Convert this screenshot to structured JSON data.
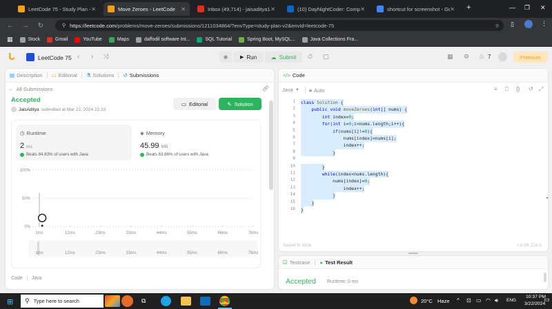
{
  "browser": {
    "tabs": [
      {
        "title": "LeetCode 75 - Study Plan - L",
        "color": "#f0a020",
        "active": false
      },
      {
        "title": "Move Zeroes - LeetCode",
        "color": "#f0a020",
        "active": true
      },
      {
        "title": "Inbox (49,714) - jaisaditya14",
        "color": "#d93025",
        "active": false
      },
      {
        "title": "(10) DayNightCoder: Compl",
        "color": "#0a66c2",
        "active": false
      },
      {
        "title": "shortcut for screenshot - Go",
        "color": "#4285f4",
        "active": false
      }
    ],
    "new_tab": "+",
    "url_host": "https://leetcode.com",
    "url_path": "/problems/move-zeroes/submissions/1211034864/?envType=study-plan-v2&envId=leetcode-75",
    "bookmarks": [
      {
        "label": "Stock",
        "color": "#9aa0a6"
      },
      {
        "label": "Gmail",
        "color": "#d93025"
      },
      {
        "label": "YouTube",
        "color": "#ff0000"
      },
      {
        "label": "Maps",
        "color": "#34a853"
      },
      {
        "label": "daffodil software Int...",
        "color": "#9aa0a6"
      },
      {
        "label": "SQL Tutorial",
        "color": "#04aa6d"
      },
      {
        "label": "Spring Boot, MySQL...",
        "color": "#6db33f"
      },
      {
        "label": "Java Collections Fra...",
        "color": "#9aa0a6"
      }
    ]
  },
  "header": {
    "study_plan": "LeetCode 75",
    "run": "Run",
    "submit": "Submit",
    "streak": "7",
    "premium": "Premium"
  },
  "left_tabs": [
    "Description",
    "Editorial",
    "Solutions",
    "Submissions"
  ],
  "submission": {
    "back": "All Submissions",
    "status": "Accepted",
    "user": "JaisAditya",
    "submitted_at": "submitted at Mar 22, 2024 22:33",
    "editorial_btn": "Editorial",
    "solution_btn": "Solution",
    "runtime": {
      "label": "Runtime",
      "value": "2",
      "unit": "ms",
      "beats_label": "Beats",
      "beats": "84.83%",
      "suffix": "of users with Java"
    },
    "memory": {
      "label": "Memory",
      "value": "45.99",
      "unit": "MB",
      "beats_label": "Beats",
      "beats": "63.86%",
      "suffix": "of users with Java"
    },
    "footer_left": "Code",
    "footer_lang": "Java"
  },
  "chart_data": {
    "type": "bar",
    "title": "",
    "xlabel": "",
    "ylabel": "",
    "categories": [
      "1ms",
      "12ms",
      "23ms",
      "33ms",
      "44ms",
      "55ms",
      "66ms",
      "76ms"
    ],
    "yticks": [
      "100%",
      "50%",
      "0%"
    ],
    "ylim": [
      0,
      100
    ],
    "values": [
      60,
      0.4,
      0.2,
      0.1,
      0.1,
      0.1,
      0.1,
      0.1
    ],
    "marker": {
      "x": "2ms",
      "y": 15
    },
    "overview_categories": [
      "1ms",
      "12ms",
      "23ms",
      "33ms",
      "44ms",
      "55ms",
      "66ms",
      "76ms"
    ]
  },
  "code_panel": {
    "title": "Code",
    "language": "Java",
    "mode": "Auto",
    "saved": "Saved to local",
    "cursor": "Ln 16, Col 2",
    "lines": [
      "class Solution {",
      "    public void moveZeroes(int[] nums) {",
      "        int index=0;",
      "        for(int i=0;i<nums.length;i++){",
      "            if(nums[i]!=0){",
      "                nums[index]=nums[i];",
      "                index++;",
      "            }",
      "",
      "        }",
      "        while(index<nums.length){",
      "            nums[index]=0;",
      "                index++;",
      "            }",
      "    }",
      "}"
    ]
  },
  "result_panel": {
    "testcase_tab": "Testcase",
    "result_tab": "Test Result",
    "status": "Accepted",
    "runtime": "Runtime: 0 ms"
  },
  "taskbar": {
    "search_placeholder": "Type here to search",
    "weather": "20°C",
    "weather_desc": "Haze",
    "lang": "ENG",
    "time": "10:37 PM",
    "date": "3/22/2024"
  },
  "colors": {
    "accent_green": "#2db55d",
    "brand_orange": "#ffa116",
    "blue_tab": "#007aff"
  }
}
